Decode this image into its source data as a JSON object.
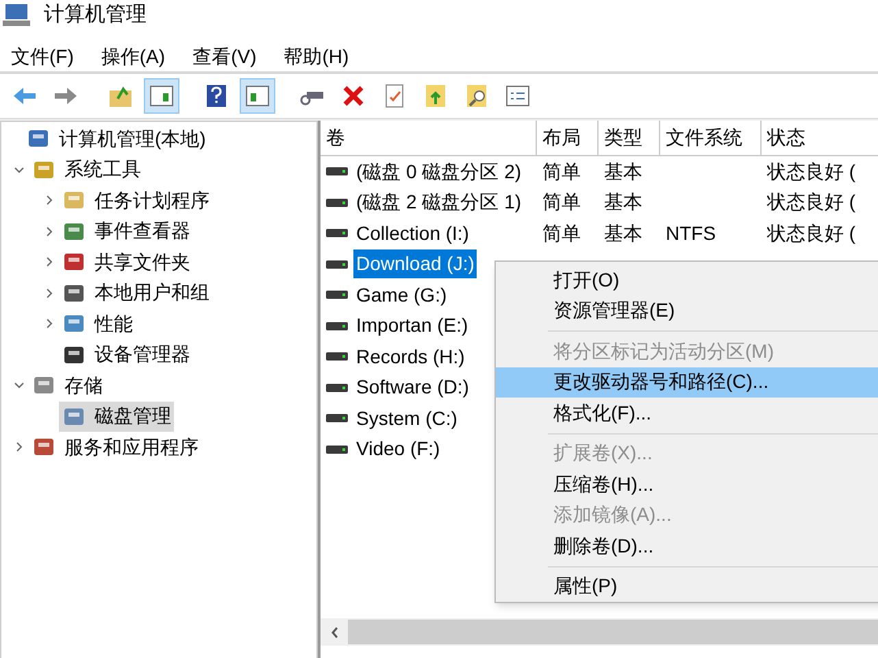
{
  "window": {
    "title": "计算机管理"
  },
  "menu_bar": [
    {
      "label": "文件(F)"
    },
    {
      "label": "操作(A)"
    },
    {
      "label": "查看(V)"
    },
    {
      "label": "帮助(H)"
    }
  ],
  "tree": [
    {
      "label": "计算机管理(本地)",
      "selected": false,
      "children": [
        {
          "label": "系统工具",
          "expanded": true,
          "selected": false,
          "children": [
            {
              "label": "任务计划程序",
              "expanded": false,
              "selected": false
            },
            {
              "label": "事件查看器",
              "expanded": false,
              "selected": false
            },
            {
              "label": "共享文件夹",
              "expanded": false,
              "selected": false
            },
            {
              "label": "本地用户和组",
              "expanded": false,
              "selected": false
            },
            {
              "label": "性能",
              "expanded": false,
              "selected": false
            },
            {
              "label": "设备管理器",
              "selected": false
            }
          ]
        },
        {
          "label": "存储",
          "expanded": true,
          "selected": false,
          "children": [
            {
              "label": "磁盘管理",
              "selected": true
            }
          ]
        },
        {
          "label": "服务和应用程序",
          "expanded": false,
          "selected": false
        }
      ]
    }
  ],
  "table": {
    "columns": [
      "卷",
      "布局",
      "类型",
      "文件系统",
      "状态"
    ],
    "rows": [
      {
        "cells": [
          "(磁盘 0 磁盘分区 2)",
          "简单",
          "基本",
          "",
          "状态良好 ("
        ],
        "selected": false
      },
      {
        "cells": [
          "(磁盘 2 磁盘分区 1)",
          "简单",
          "基本",
          "",
          "状态良好 ("
        ],
        "selected": false
      },
      {
        "cells": [
          "Collection (I:)",
          "简单",
          "基本",
          "NTFS",
          "状态良好 ("
        ],
        "selected": false
      },
      {
        "cells": [
          "Download (J:)"
        ],
        "selected": true
      },
      {
        "cells": [
          "Game (G:)"
        ],
        "selected": false
      },
      {
        "cells": [
          "Importan (E:)"
        ],
        "selected": false
      },
      {
        "cells": [
          "Records (H:)"
        ],
        "selected": false
      },
      {
        "cells": [
          "Software (D:)"
        ],
        "selected": false
      },
      {
        "cells": [
          "System (C:)"
        ],
        "selected": false
      },
      {
        "cells": [
          "Video (F:)"
        ],
        "selected": false
      }
    ]
  },
  "context_menu": [
    {
      "kind": "item",
      "label": "打开(O)",
      "disabled": false,
      "selected": false
    },
    {
      "kind": "item",
      "label": "资源管理器(E)",
      "disabled": false,
      "selected": false
    },
    {
      "kind": "separator"
    },
    {
      "kind": "item",
      "label": "将分区标记为活动分区(M)",
      "disabled": true,
      "selected": false
    },
    {
      "kind": "item",
      "label": "更改驱动器号和路径(C)...",
      "disabled": false,
      "selected": true
    },
    {
      "kind": "item",
      "label": "格式化(F)...",
      "disabled": false,
      "selected": false
    },
    {
      "kind": "separator"
    },
    {
      "kind": "item",
      "label": "扩展卷(X)...",
      "disabled": true,
      "selected": false
    },
    {
      "kind": "item",
      "label": "压缩卷(H)...",
      "disabled": false,
      "selected": false
    },
    {
      "kind": "item",
      "label": "添加镜像(A)...",
      "disabled": true,
      "selected": false
    },
    {
      "kind": "item",
      "label": "删除卷(D)...",
      "disabled": false,
      "selected": false
    },
    {
      "kind": "separator"
    },
    {
      "kind": "item",
      "label": "属性(P)",
      "disabled": false,
      "selected": false
    }
  ]
}
